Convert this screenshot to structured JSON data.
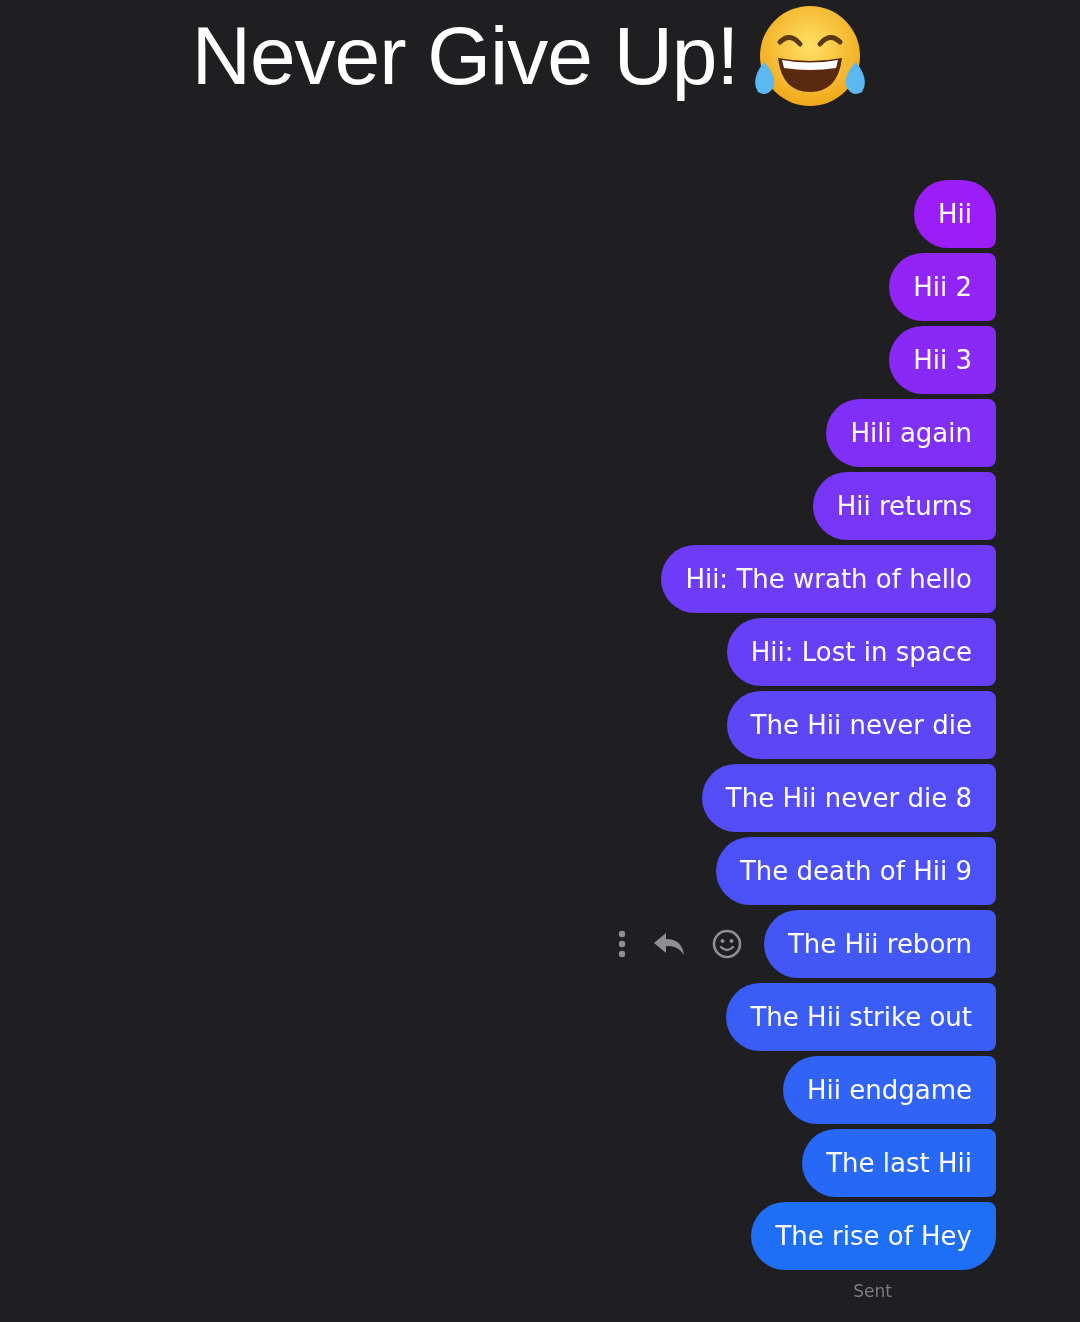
{
  "title": "Never Give Up!",
  "messages": [
    {
      "text": "Hii",
      "hovered": false
    },
    {
      "text": "Hii 2",
      "hovered": false
    },
    {
      "text": "Hii 3",
      "hovered": false
    },
    {
      "text": "Hili again",
      "hovered": false
    },
    {
      "text": "Hii returns",
      "hovered": false
    },
    {
      "text": "Hii: The wrath of hello",
      "hovered": false
    },
    {
      "text": "Hii: Lost in space",
      "hovered": false
    },
    {
      "text": "The Hii never die",
      "hovered": false
    },
    {
      "text": "The Hii never die 8",
      "hovered": false
    },
    {
      "text": "The death of Hii 9",
      "hovered": false
    },
    {
      "text": "The Hii reborn",
      "hovered": true
    },
    {
      "text": "The Hii strike out",
      "hovered": false
    },
    {
      "text": "Hii endgame",
      "hovered": false
    },
    {
      "text": "The last Hii",
      "hovered": false
    },
    {
      "text": "The rise of Hey",
      "hovered": false
    }
  ],
  "status": "Sent"
}
